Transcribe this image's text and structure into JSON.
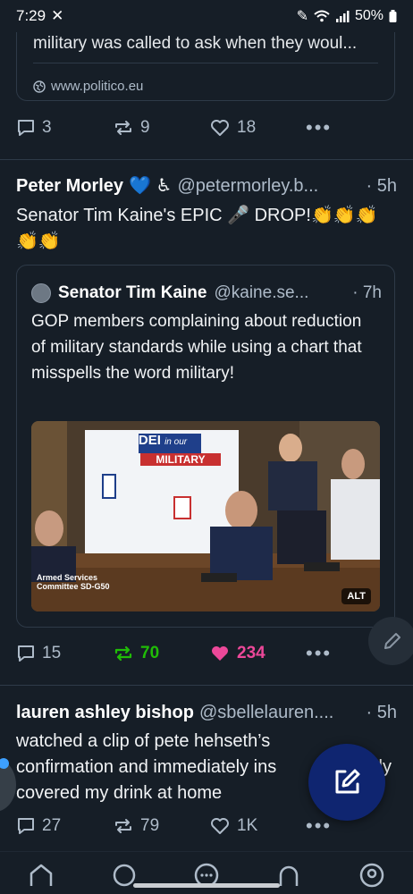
{
  "status_bar": {
    "time": "7:29",
    "battery": "50%"
  },
  "link_card": {
    "description": "military was called to ask when they woul...",
    "domain": "www.politico.eu"
  },
  "post1_actions": {
    "replies": "3",
    "reposts": "9",
    "likes": "18"
  },
  "post2": {
    "name": "Peter Morley",
    "badges": "💙 ♿",
    "handle": "@petermorley.b...",
    "time": "· 5h",
    "text": "Senator Tim Kaine's EPIC 🎤 DROP!👏👏👏👏👏",
    "quote": {
      "name": "Senator Tim Kaine",
      "handle": "@kaine.se...",
      "time": "· 7h",
      "text": "GOP members complaining about reduction of military standards while using a chart that misspells the word military!",
      "image": {
        "sign_title": "DEI",
        "sign_sub": "in our",
        "sign_word": "MILITARY",
        "caption": "Armed Services Committee SD-G50",
        "alt_label": "ALT"
      }
    },
    "actions": {
      "replies": "15",
      "reposts": "70",
      "likes": "234"
    }
  },
  "post3": {
    "name": "lauren ashley bishop",
    "handle": "@sbellelauren....",
    "time": "· 5h",
    "text_line1": "watched a clip of pete hehseth’s",
    "text_line2": "confirmation and immediately ins",
    "text_line2_end": "ly",
    "text_line3": "covered my drink at home",
    "actions": {
      "replies": "27",
      "reposts": "79",
      "likes": "1K"
    }
  },
  "colors": {
    "background": "#161e27",
    "repost_active": "#20bc07",
    "like_active": "#ec4899",
    "compose_fab": "#0f2570"
  },
  "icons": [
    "reply-icon",
    "repost-icon",
    "like-icon",
    "more-icon",
    "globe-icon",
    "compose-icon",
    "pencil-icon",
    "home-icon",
    "search-icon",
    "chat-icon",
    "notifications-icon",
    "profile-icon"
  ]
}
